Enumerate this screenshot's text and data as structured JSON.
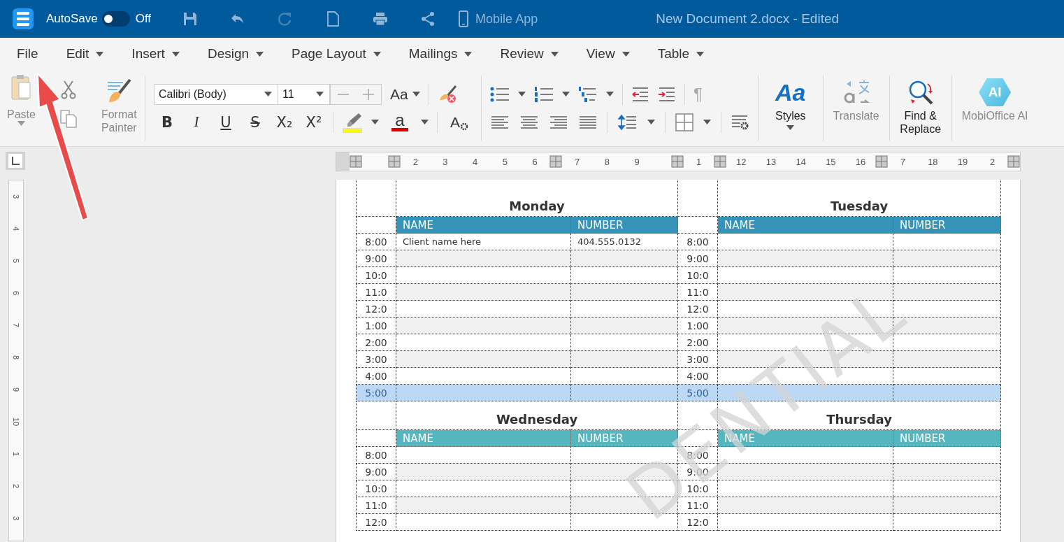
{
  "title_bar": {
    "autosave_label": "AutoSave",
    "autosave_on": false,
    "autosave_state": "Off",
    "quick_actions": [
      {
        "kind": "save",
        "disabled": false
      },
      {
        "kind": "undo",
        "disabled": false
      },
      {
        "kind": "redo",
        "disabled": true
      },
      {
        "kind": "new",
        "disabled": false
      },
      {
        "kind": "print",
        "disabled": false
      },
      {
        "kind": "share",
        "disabled": false
      }
    ],
    "mobile_app": "Mobile App",
    "document_title": "New Document 2.docx - Edited"
  },
  "menu": [
    {
      "label": "File",
      "has_dropdown": false
    },
    {
      "label": "Edit",
      "has_dropdown": true
    },
    {
      "label": "Insert",
      "has_dropdown": true
    },
    {
      "label": "Design",
      "has_dropdown": true
    },
    {
      "label": "Page Layout",
      "has_dropdown": true
    },
    {
      "label": "Mailings",
      "has_dropdown": true
    },
    {
      "label": "Review",
      "has_dropdown": true
    },
    {
      "label": "View",
      "has_dropdown": true
    },
    {
      "label": "Table",
      "has_dropdown": true
    }
  ],
  "ribbon": {
    "paste_label": "Paste",
    "format_painter_label": "Format Painter",
    "font_name": "Calibri (Body)",
    "font_size": "11",
    "change_case": "Aa",
    "format_buttons": [
      {
        "kind": "bold",
        "label": "B"
      },
      {
        "kind": "italic",
        "label": "I"
      },
      {
        "kind": "underline",
        "label": "U"
      },
      {
        "kind": "strike",
        "label": "S"
      },
      {
        "kind": "subscript",
        "label": "X₂"
      },
      {
        "kind": "superscript",
        "label": "X²"
      }
    ],
    "font_color_glyph": "a",
    "style_settings_glyph": "A",
    "pilcrow": "¶",
    "large_buttons": [
      {
        "kind": "styles",
        "glyph": "Aa",
        "label": "Styles",
        "disabled": false,
        "has_dropdown": true
      },
      {
        "kind": "translate",
        "label": "Translate",
        "disabled": true,
        "has_dropdown": false
      },
      {
        "kind": "find",
        "label": "Find & Replace",
        "disabled": false,
        "has_dropdown": false
      },
      {
        "kind": "ai",
        "glyph": "AI",
        "label": "MobiOffice AI",
        "disabled": true,
        "has_dropdown": false
      }
    ]
  },
  "rulers": {
    "horizontal": [
      "2",
      "3",
      "4",
      "5",
      "6",
      "7",
      "8",
      "9",
      "1",
      "12",
      "13",
      "14",
      "15",
      "16",
      "7",
      "18",
      "19",
      "2"
    ],
    "vertical": [
      "3",
      "4",
      "5",
      "6",
      "7",
      "8",
      "9",
      "10",
      "1",
      "2",
      "3"
    ]
  },
  "watermark": "DENTIAL",
  "schedule": [
    {
      "days": [
        {
          "name": "Monday",
          "color": "#3592b8",
          "name_heading": "NAME",
          "number_heading": "NUMBER"
        },
        {
          "name": "Tuesday",
          "color": "#3592b8",
          "name_heading": "NAME",
          "number_heading": "NUMBER"
        }
      ],
      "rows": [
        {
          "selected": false,
          "cells": [
            {
              "time": "8:00",
              "name": "Client name here",
              "number": "404.555.0132"
            },
            {
              "time": "8:00"
            }
          ]
        },
        {
          "selected": false,
          "cells": [
            {
              "time": "9:00"
            },
            {
              "time": "9:00"
            }
          ]
        },
        {
          "selected": false,
          "cells": [
            {
              "time": "10:0"
            },
            {
              "time": "10:0"
            }
          ]
        },
        {
          "selected": false,
          "cells": [
            {
              "time": "11:0"
            },
            {
              "time": "11:0"
            }
          ]
        },
        {
          "selected": false,
          "cells": [
            {
              "time": "12:0"
            },
            {
              "time": "12:0"
            }
          ]
        },
        {
          "selected": false,
          "cells": [
            {
              "time": "1:00"
            },
            {
              "time": "1:00"
            }
          ]
        },
        {
          "selected": false,
          "cells": [
            {
              "time": "2:00"
            },
            {
              "time": "2:00"
            }
          ]
        },
        {
          "selected": false,
          "cells": [
            {
              "time": "3:00"
            },
            {
              "time": "3:00"
            }
          ]
        },
        {
          "selected": false,
          "cells": [
            {
              "time": "4:00"
            },
            {
              "time": "4:00"
            }
          ]
        },
        {
          "selected": true,
          "cells": [
            {
              "time": "5:00"
            },
            {
              "time": "5:00"
            }
          ]
        }
      ]
    },
    {
      "days": [
        {
          "name": "Wednesday",
          "color": "#55b6c0",
          "name_heading": "NAME",
          "number_heading": "NUMBER"
        },
        {
          "name": "Thursday",
          "color": "#55b6c0",
          "name_heading": "NAME",
          "number_heading": "NUMBER"
        }
      ],
      "rows": [
        {
          "selected": false,
          "cells": [
            {
              "time": "8:00"
            },
            {
              "time": "8:00"
            }
          ]
        },
        {
          "selected": false,
          "cells": [
            {
              "time": "9:00"
            },
            {
              "time": "9:00"
            }
          ]
        },
        {
          "selected": false,
          "cells": [
            {
              "time": "10:0"
            },
            {
              "time": "10:0"
            }
          ]
        },
        {
          "selected": false,
          "cells": [
            {
              "time": "11:0"
            },
            {
              "time": "11:0"
            }
          ]
        },
        {
          "selected": false,
          "cells": [
            {
              "time": "12:0"
            },
            {
              "time": "12:0"
            }
          ]
        }
      ]
    }
  ]
}
